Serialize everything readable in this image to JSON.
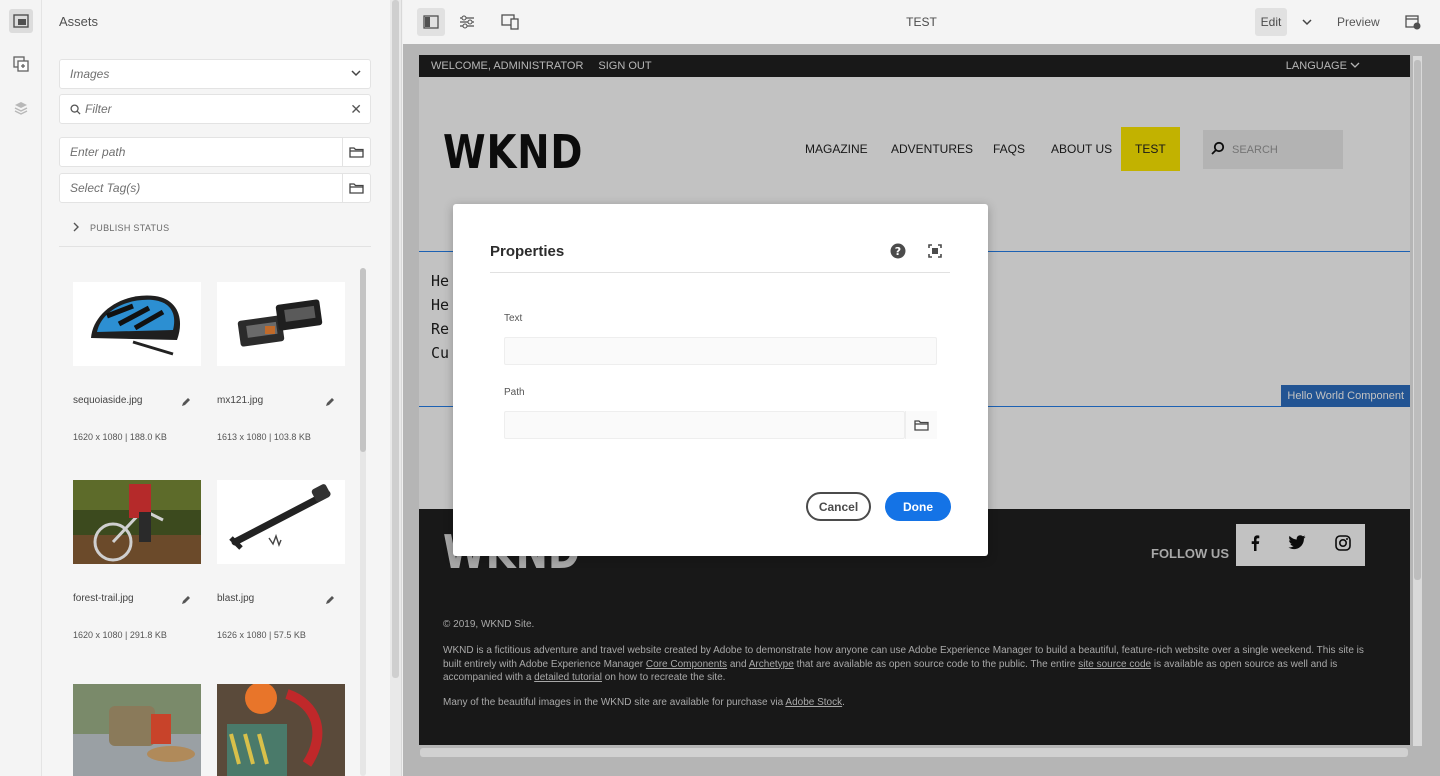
{
  "rail": {
    "items": [
      {
        "icon": "assets-icon",
        "active": true
      },
      {
        "icon": "components-icon",
        "active": false
      },
      {
        "icon": "layers-icon",
        "active": false
      }
    ]
  },
  "assets": {
    "title": "Assets",
    "type_select": "Images",
    "filter_placeholder": "Filter",
    "path_placeholder": "Enter path",
    "tags_placeholder": "Select Tag(s)",
    "publish_status": "PUBLISH STATUS",
    "cards": [
      {
        "name": "sequoiaside.jpg",
        "meta": "1620 x 1080 | 188.0 KB"
      },
      {
        "name": "mx121.jpg",
        "meta": "1613 x 1080 | 103.8 KB"
      },
      {
        "name": "forest-trail.jpg",
        "meta": "1620 x 1080 | 291.8 KB"
      },
      {
        "name": "blast.jpg",
        "meta": "1626 x 1080 | 57.5 KB"
      },
      {
        "name": "",
        "meta": ""
      },
      {
        "name": "",
        "meta": ""
      }
    ]
  },
  "toolbar": {
    "title": "TEST",
    "edit_label": "Edit",
    "preview_label": "Preview"
  },
  "site": {
    "top_left": [
      "WELCOME, ADMINISTRATOR",
      "SIGN OUT"
    ],
    "language": "LANGUAGE",
    "logo": "WKND",
    "nav": [
      "MAGAZINE",
      "ADVENTURES",
      "FAQS",
      "ABOUT US",
      "TEST"
    ],
    "search_placeholder": "SEARCH",
    "hello_lines": [
      "He",
      "He",
      "Re",
      "Cu"
    ],
    "component_label": "Hello World Component",
    "footer": {
      "logo": "WKND",
      "follow": "FOLLOW US",
      "copyright": "© 2019,  WKND Site.",
      "para_1": "WKND is a fictitious adventure and travel website created by Adobe to demonstrate how anyone can use Adobe Experience Manager to build a beautiful, feature-rich website over a single weekend. This site is built entirely with Adobe Experience Manager ",
      "link_core": "Core Components",
      "and": " and ",
      "link_archetype": "Archetype",
      "para_2": " that are available as open source code to the public. The entire ",
      "link_source": "site source code",
      "para_3": " is available as open source as well and is accompanied with a ",
      "link_tutorial": "detailed tutorial",
      "para_4": " on how to recreate the site.",
      "stock_text": "Many of the beautiful images in the WKND site are available for purchase via ",
      "link_stock": "Adobe Stock",
      "stock_end": "."
    }
  },
  "dialog": {
    "title": "Properties",
    "text_label": "Text",
    "path_label": "Path",
    "cancel": "Cancel",
    "done": "Done"
  },
  "colors": {
    "accent": "#1473e6",
    "nav_active": "#ffea00",
    "component_border": "#2680eb"
  }
}
